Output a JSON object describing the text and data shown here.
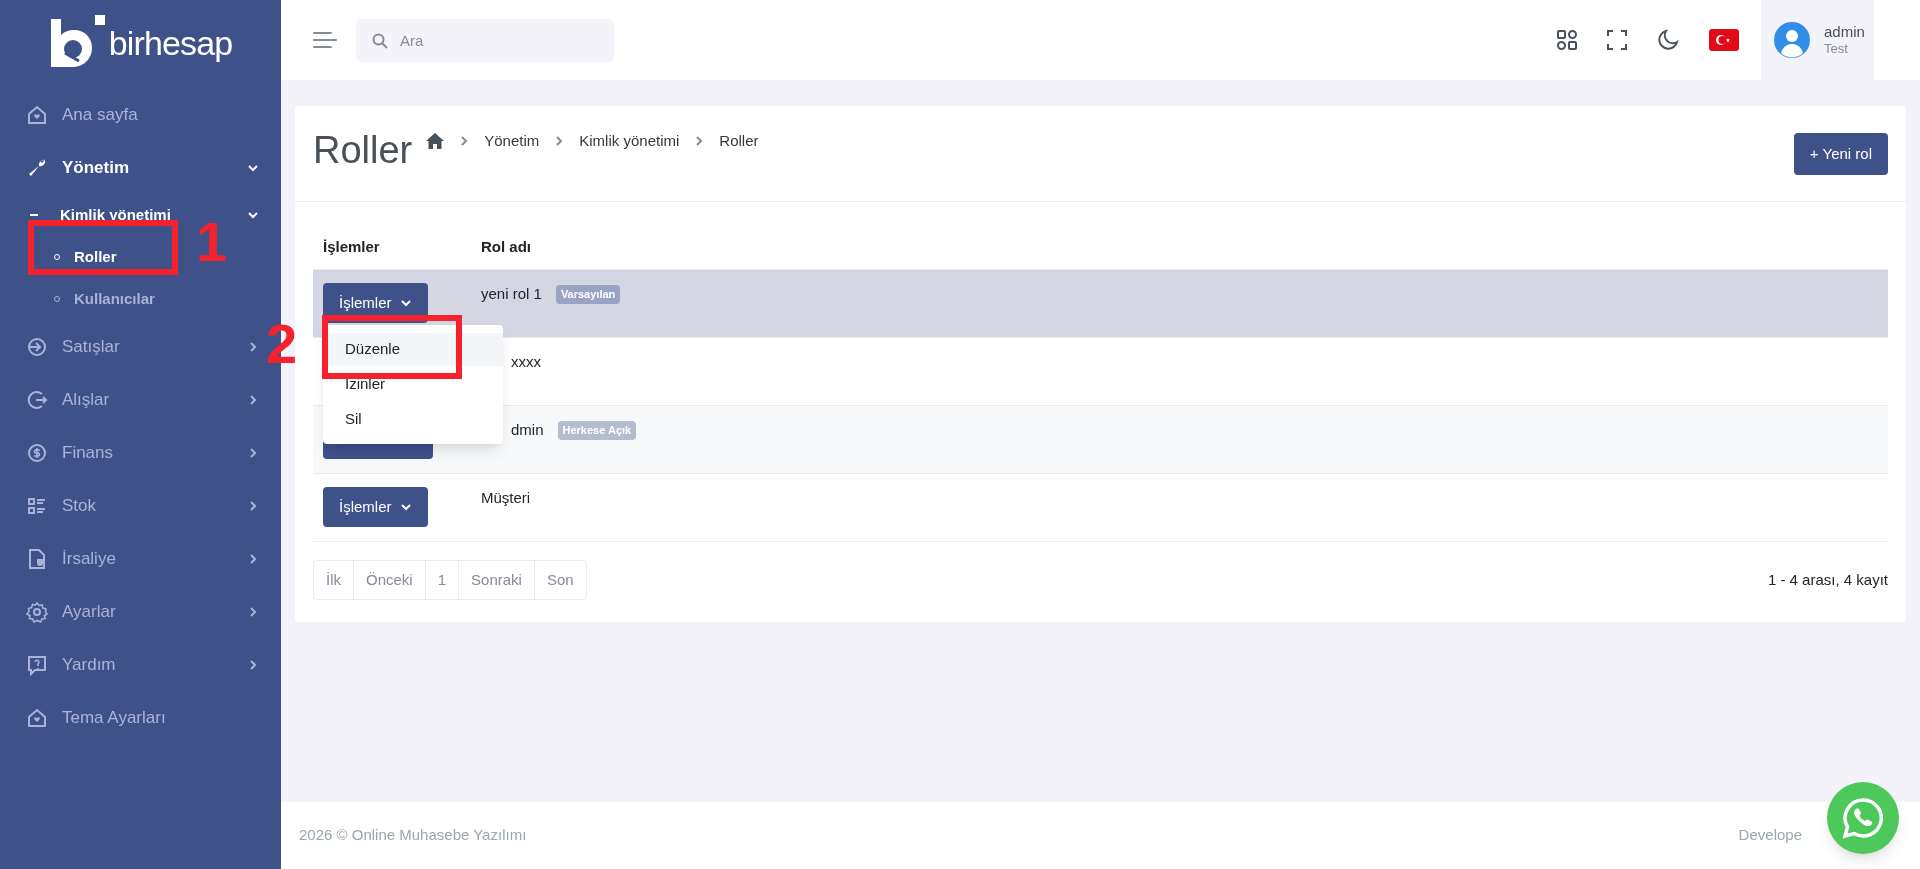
{
  "brand": {
    "name": "birhesap"
  },
  "sidebar": {
    "items": [
      {
        "kind": "link",
        "label": "Ana sayfa",
        "expanded": false
      },
      {
        "kind": "group",
        "label": "Yönetim",
        "expanded": true,
        "children": [
          {
            "label": "Kimlik yönetimi",
            "expanded": true,
            "children": [
              {
                "label": "Roller",
                "selected": true
              },
              {
                "label": "Kullanıcılar",
                "selected": false
              }
            ]
          }
        ]
      },
      {
        "kind": "group",
        "label": "Satışlar",
        "expanded": false
      },
      {
        "kind": "group",
        "label": "Alışlar",
        "expanded": false
      },
      {
        "kind": "group",
        "label": "Finans",
        "expanded": false
      },
      {
        "kind": "group",
        "label": "Stok",
        "expanded": false
      },
      {
        "kind": "group",
        "label": "İrsaliye",
        "expanded": false
      },
      {
        "kind": "group",
        "label": "Ayarlar",
        "expanded": false
      },
      {
        "kind": "group",
        "label": "Yardım",
        "expanded": false
      },
      {
        "kind": "link",
        "label": "Tema Ayarları",
        "expanded": false
      }
    ]
  },
  "search": {
    "placeholder": "Ara"
  },
  "user": {
    "name": "admin",
    "role": "Test"
  },
  "page": {
    "title": "Roller",
    "breadcrumb": [
      "Yönetim",
      "Kimlik yönetimi",
      "Roller"
    ],
    "new_button": "+ Yeni rol"
  },
  "table": {
    "columns": [
      "İşlemler",
      "Rol adı"
    ],
    "rows": [
      {
        "kind": "button",
        "action": "İşlemler",
        "name": "yeni rol 1",
        "badge": "Varsayılan",
        "selected": true,
        "menu": [
          {
            "label": "Düzenle",
            "selected": true
          },
          {
            "label": "İzinler",
            "selected": false
          },
          {
            "label": "Sil",
            "selected": false
          }
        ]
      },
      {
        "kind": "hidden",
        "name": "xxxx",
        "selected": false
      },
      {
        "kind": "stub",
        "name": "dmin",
        "badge": "Herkese Açık",
        "selected": false
      },
      {
        "kind": "button",
        "action": "İşlemler",
        "name": "Müşteri",
        "selected": false
      }
    ]
  },
  "pagination": {
    "buttons": [
      "İlk",
      "Önceki",
      "1",
      "Sonraki",
      "Son"
    ],
    "summary": "1 - 4 arası, 4 kayıt"
  },
  "footer": {
    "copyright": "2026 © Online Muhasebe Yazılımı",
    "credit": "Develope"
  },
  "annotations": [
    {
      "label": "1"
    },
    {
      "label": "2"
    }
  ]
}
